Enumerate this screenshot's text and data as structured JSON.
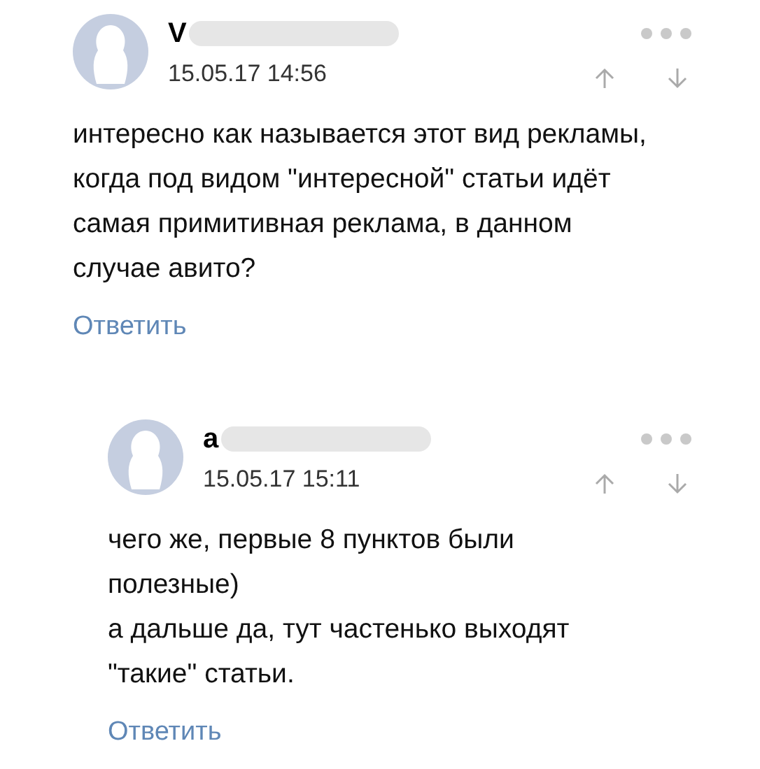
{
  "comments": [
    {
      "author": "V",
      "date": "15.05.17 14:56",
      "text": "интересно как называется этот вид рекламы, когда под видом \"интересной\" статьи идёт самая примитивная реклама, в данном случае авито?",
      "reply_label": "Ответить",
      "children": [
        {
          "author": "a",
          "date": "15.05.17 15:11",
          "text": "чего же, первые 8 пунктов были полезные)\nа дальше да, тут частенько выходят \"такие\" статьи.",
          "reply_label": "Ответить"
        }
      ]
    }
  ]
}
